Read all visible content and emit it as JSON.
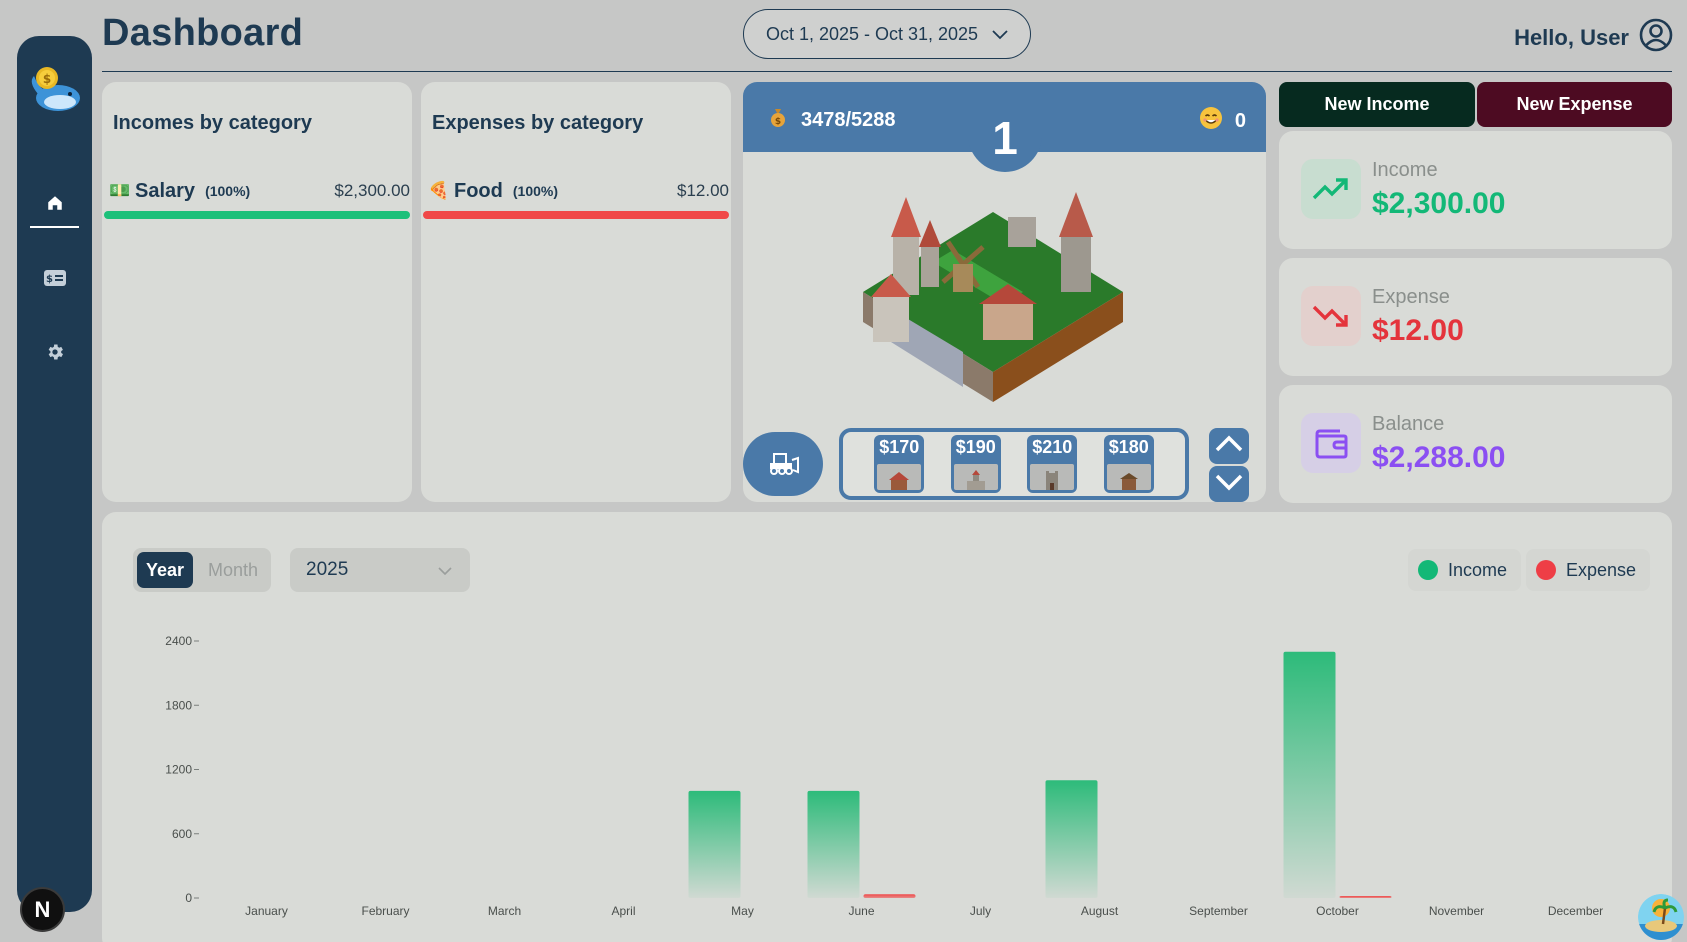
{
  "header": {
    "title": "Dashboard",
    "date_range": "Oct 1, 2025 - Oct 31, 2025",
    "greeting": "Hello, User"
  },
  "sidebar": {
    "items": [
      {
        "name": "home-icon",
        "active": true
      },
      {
        "name": "card-icon",
        "active": false
      },
      {
        "name": "gear-icon",
        "active": false
      }
    ],
    "badge": "N"
  },
  "incomes": {
    "title": "Incomes by category",
    "row": {
      "emoji": "💵",
      "name": "Salary",
      "percent": "(100%)",
      "amount": "$2,300.00",
      "color": "#1cc07a"
    }
  },
  "expenses": {
    "title": "Expenses by category",
    "row": {
      "emoji": "🍕",
      "name": "Food",
      "percent": "(100%)",
      "amount": "$12.00",
      "color": "#f04848"
    }
  },
  "game": {
    "coins": "3478/5288",
    "coin_icon": "money-bag-icon",
    "happiness": "0",
    "happiness_icon": "smile-icon",
    "level": "1",
    "shop": [
      {
        "price": "$170",
        "icon": "house-icon"
      },
      {
        "price": "$190",
        "icon": "church-icon"
      },
      {
        "price": "$210",
        "icon": "tower-icon"
      },
      {
        "price": "$180",
        "icon": "hut-icon"
      }
    ]
  },
  "actions": {
    "new_income": "New Income",
    "new_expense": "New Expense",
    "income_color": "#062a1f",
    "expense_color": "#4d0b22"
  },
  "summary": {
    "income": {
      "label": "Income",
      "value": "$2,300.00",
      "color": "#13b877",
      "icon": "trend-up-icon"
    },
    "expense": {
      "label": "Expense",
      "value": "$12.00",
      "color": "#e4343c",
      "icon": "trend-down-icon"
    },
    "balance": {
      "label": "Balance",
      "value": "$2,288.00",
      "color": "#8b4ff2",
      "icon": "wallet-icon"
    }
  },
  "chart_controls": {
    "year_tab": "Year",
    "month_tab": "Month",
    "selected_year": "2025",
    "legend_income": "Income",
    "legend_expense": "Expense"
  },
  "chart_data": {
    "type": "bar",
    "categories": [
      "January",
      "February",
      "March",
      "April",
      "May",
      "June",
      "July",
      "August",
      "September",
      "October",
      "November",
      "December"
    ],
    "series": [
      {
        "name": "Income",
        "color": "#2dbb7a",
        "values": [
          0,
          0,
          0,
          0,
          1000,
          1000,
          0,
          1100,
          0,
          2300,
          0,
          0
        ]
      },
      {
        "name": "Expense",
        "color": "#f04848",
        "values": [
          0,
          0,
          0,
          0,
          0,
          35,
          0,
          0,
          0,
          12,
          0,
          0
        ]
      }
    ],
    "yticks": [
      "0",
      "600",
      "1200",
      "1800",
      "2400"
    ],
    "ylim": [
      0,
      2400
    ],
    "grid": false
  }
}
